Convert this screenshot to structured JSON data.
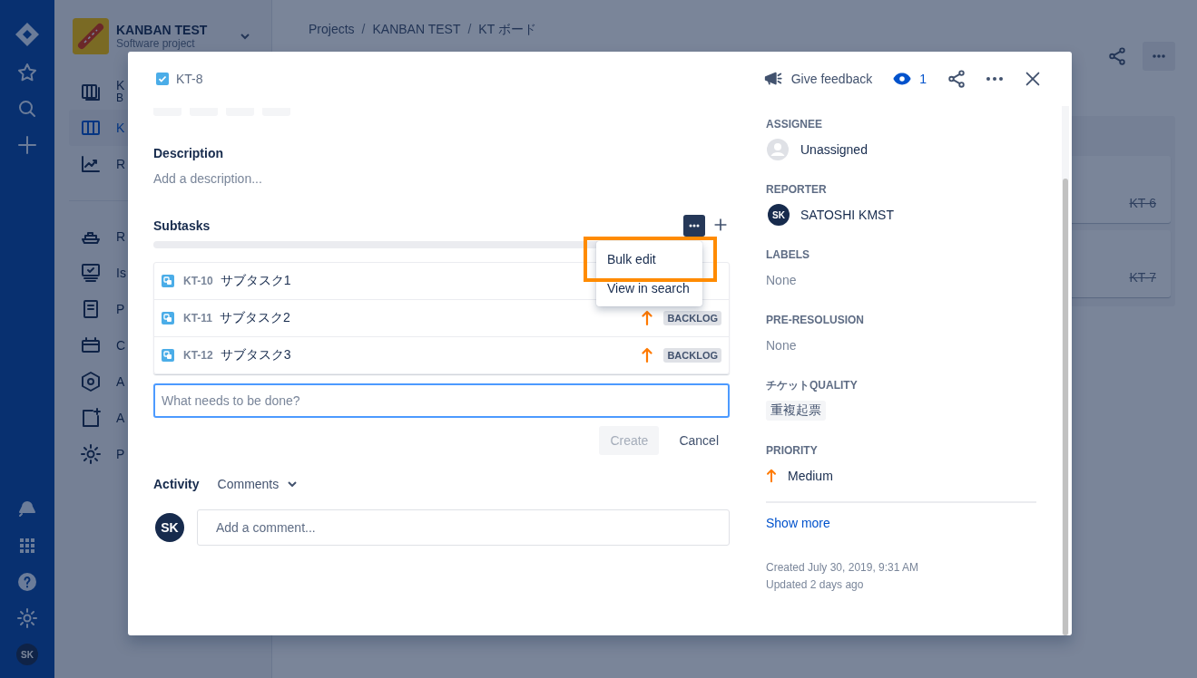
{
  "global_nav": {
    "avatar": "SK"
  },
  "project": {
    "name": "KANBAN TEST",
    "type": "Software project"
  },
  "sidebar": {
    "items": [
      {
        "label": "K",
        "sublabel": "B",
        "selected": false
      },
      {
        "label": "K",
        "selected": true
      },
      {
        "label": "R",
        "selected": false
      },
      {
        "label": "R",
        "selected": false
      },
      {
        "label": "Is",
        "selected": false
      },
      {
        "label": "P",
        "selected": false
      },
      {
        "label": "C",
        "selected": false
      },
      {
        "label": "A",
        "selected": false
      },
      {
        "label": "A",
        "selected": false
      },
      {
        "label": "P",
        "selected": false
      }
    ]
  },
  "breadcrumbs": [
    {
      "text": "Projects",
      "kind": "link"
    },
    {
      "text": "/",
      "kind": "separator"
    },
    {
      "text": "KANBAN TEST",
      "kind": "link"
    },
    {
      "text": "/",
      "kind": "separator"
    },
    {
      "text": "KT ボード",
      "kind": "link"
    }
  ],
  "board": {
    "cards": [
      {
        "key": "KT-6",
        "done": true
      },
      {
        "key": "KT-7",
        "done": true
      }
    ]
  },
  "issue": {
    "key": "KT-8",
    "feedback": "Give feedback",
    "watchers": "1"
  },
  "description": {
    "label": "Description",
    "placeholder": "Add a description..."
  },
  "subtasks": {
    "label": "Subtasks",
    "menu_open": true,
    "progress": {
      "level": 0
    },
    "rows": [
      {
        "key": "KT-10",
        "summary": "サブタスク1"
      },
      {
        "key": "KT-11",
        "summary": "サブタスク2",
        "color": "#ff7a00",
        "status": "BACKLOG"
      },
      {
        "key": "KT-12",
        "summary": "サブタスク3",
        "color": "#ff7a00",
        "status": "BACKLOG"
      }
    ],
    "new_placeholder": "What needs to be done?",
    "create": {
      "label": "Create",
      "disabled": true
    },
    "cancel": "Cancel"
  },
  "menu": {
    "items": [
      {
        "label": "Bulk edit",
        "annotated": true
      },
      {
        "label": "View in search",
        "annotated": false
      }
    ]
  },
  "activity": {
    "label": "Activity",
    "filter": "Comments",
    "avatar": "SK",
    "placeholder": "Add a comment..."
  },
  "fields": [
    {
      "label": "ASSIGNEE",
      "kind": "user",
      "value": "Unassigned"
    },
    {
      "label": "REPORTER",
      "kind": "user",
      "value": "SATOSHI KMST",
      "initials": "SK"
    },
    {
      "label": "LABELS",
      "kind": "none",
      "value": "None"
    },
    {
      "label": "PRE-RESOLUSION",
      "kind": "none",
      "value": "None"
    },
    {
      "label": "チケットQUALITY",
      "kind": "tag",
      "value": "重複起票"
    },
    {
      "label": "PRIORITY",
      "kind": "priority",
      "value": "Medium",
      "color": "#ff7a00"
    }
  ],
  "show_more": "Show more",
  "created": "Created July 30, 2019, 9:31 AM",
  "updated": "Updated 2 days ago"
}
